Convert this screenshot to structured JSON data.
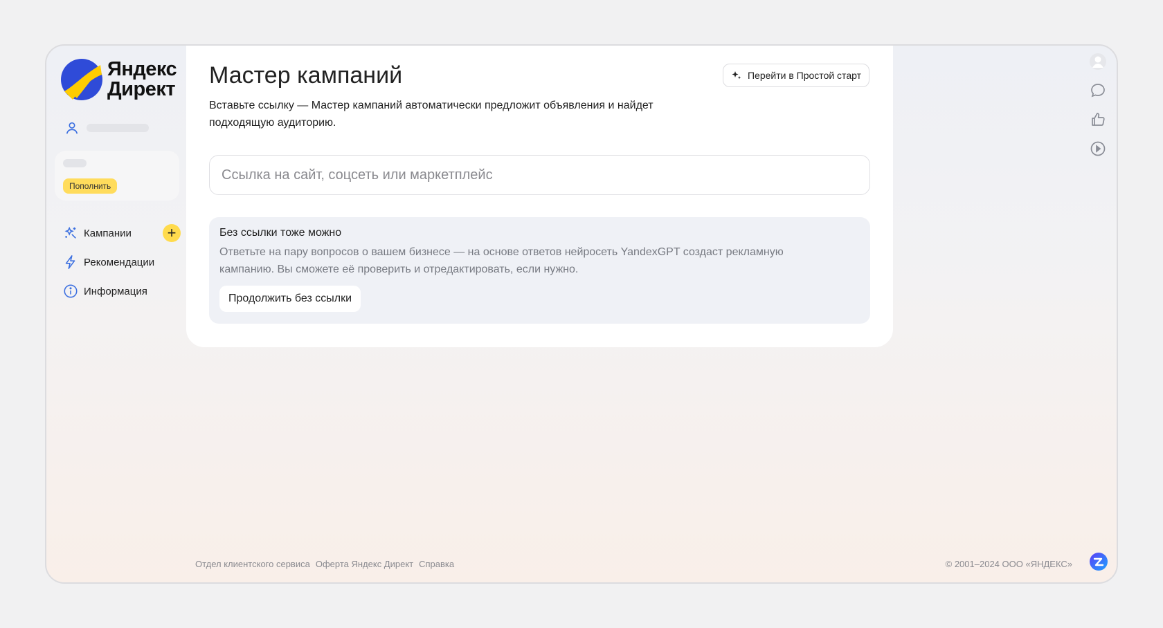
{
  "logo": {
    "line1": "Яндекс",
    "line2": "Директ",
    "colors": {
      "yellow": "#ffcc00",
      "blue": "#2f4bd8"
    }
  },
  "sidebar": {
    "topup_label": "Пополнить",
    "items": [
      {
        "label": "Кампании",
        "icon": "campaigns-icon"
      },
      {
        "label": "Рекомендации",
        "icon": "lightning-icon"
      },
      {
        "label": "Информация",
        "icon": "info-icon"
      }
    ]
  },
  "main": {
    "title": "Мастер кампаний",
    "simple_start_label": "Перейти в Простой старт",
    "subtitle": "Вставьте ссылку — Мастер кампаний автоматически предложит объявления и найдет подходящую аудиторию.",
    "url_placeholder": "Ссылка на сайт, соцсеть или маркетплейс",
    "no_link": {
      "title": "Без ссылки тоже можно",
      "text": "Ответьте на пару вопросов о вашем бизнесе — на основе ответов нейросеть YandexGPT создаст рекламную кампанию. Вы сможете её проверить и отредактировать, если нужно.",
      "button_label": "Продолжить без ссылки"
    }
  },
  "right_rail": [
    "avatar-icon",
    "chat-icon",
    "thumbs-up-icon",
    "play-icon"
  ],
  "footer": {
    "links": [
      "Отдел клиентского сервиса",
      "Оферта Яндекс Директ",
      "Справка"
    ],
    "copyright": "© 2001–2024 ООО «ЯНДЕКС»"
  },
  "colors": {
    "accent": "#ffdb4d",
    "icon_blue": "#3b6fe0",
    "muted_text": "#777a82"
  }
}
